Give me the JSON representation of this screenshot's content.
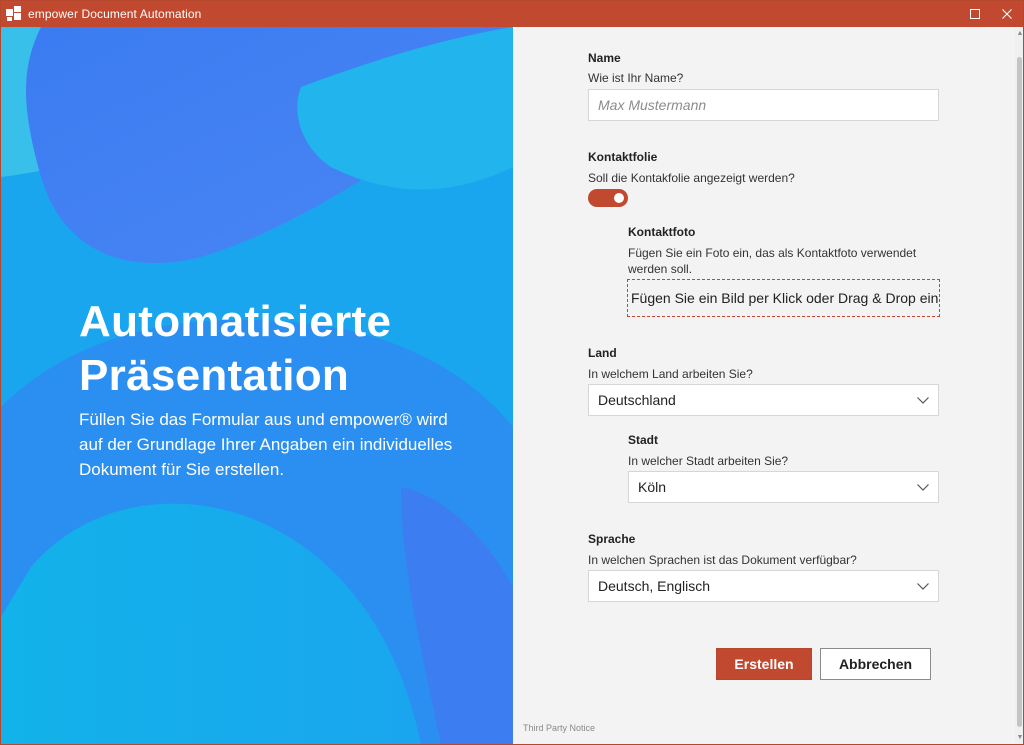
{
  "window": {
    "title": "empower Document Automation"
  },
  "hero": {
    "heading_line1": "Automatisierte",
    "heading_line2": "Präsentation",
    "description": "Füllen Sie das Formular aus und empower® wird auf der Grundlage Ihrer Angaben ein individuelles Dokument für Sie erstellen."
  },
  "form": {
    "name": {
      "title": "Name",
      "description": "Wie ist Ihr Name?",
      "placeholder": "Max Mustermann",
      "value": ""
    },
    "contact_slide": {
      "title": "Kontaktfolie",
      "description": "Soll die Kontakfolie angezeigt werden?",
      "enabled": true
    },
    "contact_photo": {
      "title": "Kontaktfoto",
      "description": "Fügen Sie ein Foto ein, das als Kontaktfoto verwendet werden soll.",
      "dropzone_label": "Fügen Sie ein Bild per Klick oder Drag & Drop ein"
    },
    "country": {
      "title": "Land",
      "description": "In welchem Land arbeiten Sie?",
      "value": "Deutschland"
    },
    "city": {
      "title": "Stadt",
      "description": "In welcher Stadt arbeiten Sie?",
      "value": "Köln"
    },
    "language": {
      "title": "Sprache",
      "description": "In welchen Sprachen ist das Dokument verfügbar?",
      "value": "Deutsch, Englisch"
    }
  },
  "actions": {
    "create_label": "Erstellen",
    "cancel_label": "Abbrechen"
  },
  "footer": {
    "third_party": "Third Party Notice"
  },
  "colors": {
    "accent": "#c0492f",
    "hero_blue": "#1a9ef0",
    "panel_bg": "#f3f3f3"
  },
  "icons": {
    "maximize": "maximize-icon",
    "close": "close-icon",
    "dropdown": "chevron-down-icon"
  }
}
